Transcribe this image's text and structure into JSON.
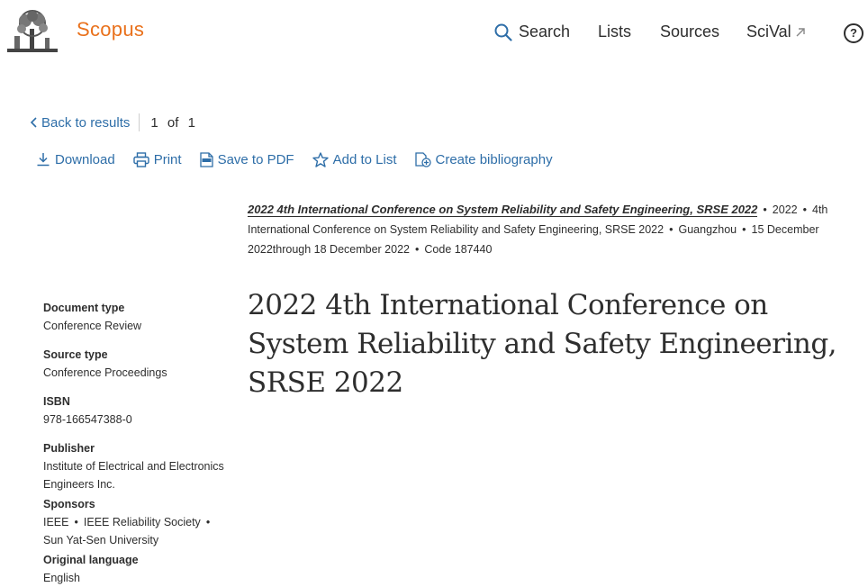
{
  "header": {
    "brand": "Scopus",
    "nav": {
      "search": "Search",
      "lists": "Lists",
      "sources": "Sources",
      "scival": "SciVal"
    },
    "help": "?"
  },
  "backbar": {
    "back_label": "Back to results",
    "pager_current": "1",
    "pager_of": "of",
    "pager_total": "1"
  },
  "actions": {
    "download": "Download",
    "print": "Print",
    "save_pdf": "Save to PDF",
    "add_list": "Add to List",
    "bibliography": "Create bibliography"
  },
  "source": {
    "title": "2022 4th International Conference on System Reliability and Safety Engineering, SRSE 2022",
    "year": "2022",
    "part3": "4th International Conference on System Reliability and Safety Engineering, SRSE 2022",
    "location": "Guangzhou",
    "dates": "15 December 2022through 18 December 2022",
    "code": "Code 187440"
  },
  "main_title": "2022 4th International Conference on System Reliability and Safety Engineering, SRSE 2022",
  "details": {
    "doc_type_label": "Document type",
    "doc_type_value": "Conference Review",
    "source_type_label": "Source type",
    "source_type_value": "Conference Proceedings",
    "isbn_label": "ISBN",
    "isbn_value": "978-166547388-0",
    "publisher_label": "Publisher",
    "publisher_value": "Institute of Electrical and Electronics Engineers Inc.",
    "sponsors_label": "Sponsors",
    "sponsor1": "IEEE",
    "sponsor2": "IEEE Reliability Society",
    "sponsor3": "Sun Yat-Sen University",
    "language_label": "Original language",
    "language_value": "English"
  },
  "colors": {
    "brand": "#e9711c",
    "link": "#2e6ea8",
    "text": "#2e2e2e"
  }
}
